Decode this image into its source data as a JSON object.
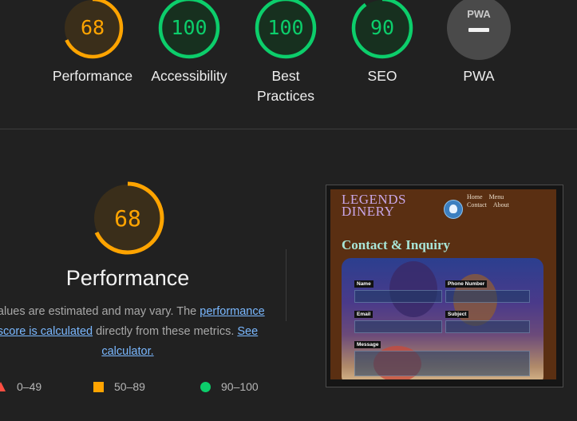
{
  "summary_gauges": [
    {
      "name": "performance",
      "score": "68",
      "label": "Performance",
      "color": "#ffa400",
      "fill": 0.68
    },
    {
      "name": "accessibility",
      "score": "100",
      "label": "Accessibility",
      "color": "#0cce6b",
      "fill": 1.0
    },
    {
      "name": "best-practices",
      "score": "100",
      "label": "Best Practices",
      "color": "#0cce6b",
      "fill": 1.0
    },
    {
      "name": "seo",
      "score": "90",
      "label": "SEO",
      "color": "#0cce6b",
      "fill": 0.9
    },
    {
      "name": "pwa",
      "score": "PWA",
      "label": "PWA",
      "color": "#9e9e9e",
      "fill": 0
    }
  ],
  "performance": {
    "score": "68",
    "color": "#ffa400",
    "fill": 0.68,
    "title": "Performance",
    "desc_before": "Values are estimated and may vary. The",
    "desc_link1": "performance score is calculated",
    "desc_mid": " directly from these metrics. ",
    "desc_link2": "See calculator."
  },
  "legend": [
    {
      "range": "0–49",
      "shape": "triangle",
      "color": "#ff4e42"
    },
    {
      "range": "50–89",
      "shape": "square",
      "color": "#ffa400"
    },
    {
      "range": "90–100",
      "shape": "circle",
      "color": "#0cce6b"
    }
  ],
  "screenshot": {
    "logo_line1": "LEGENDS",
    "logo_line2": "DINERY",
    "nav_row1": [
      "Home",
      "Menu"
    ],
    "nav_row2": [
      "Contact",
      "About"
    ],
    "heading": "Contact & Inquiry",
    "fields": [
      "Name",
      "Phone Number",
      "Email",
      "Subject",
      "Message"
    ]
  }
}
